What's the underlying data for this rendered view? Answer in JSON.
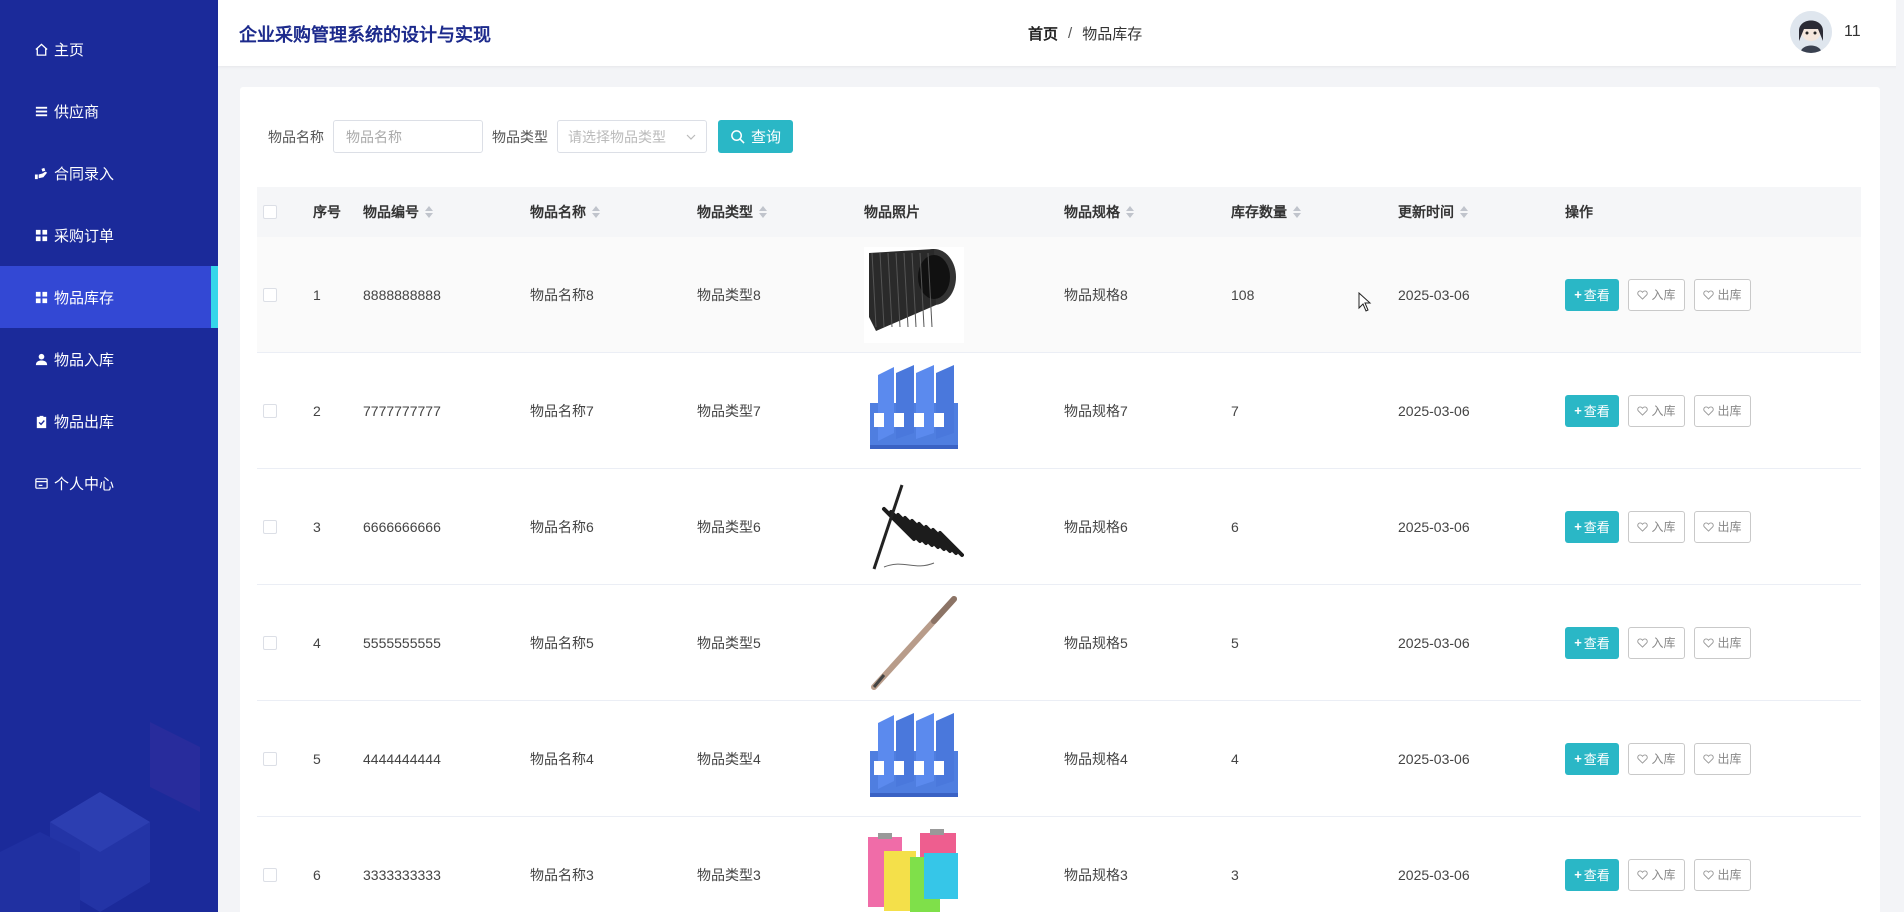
{
  "app_title": "企业采购管理系统的设计与实现",
  "breadcrumb": {
    "home": "首页",
    "separator": "/",
    "current": "物品库存"
  },
  "user": {
    "name": "11"
  },
  "sidebar": {
    "items": [
      {
        "label": "主页",
        "icon": "home-icon"
      },
      {
        "label": "供应商",
        "icon": "list-icon"
      },
      {
        "label": "合同录入",
        "icon": "hand-icon"
      },
      {
        "label": "采购订单",
        "icon": "grid-icon"
      },
      {
        "label": "物品库存",
        "icon": "grid-icon",
        "active": true
      },
      {
        "label": "物品入库",
        "icon": "user-icon"
      },
      {
        "label": "物品出库",
        "icon": "clipboard-icon"
      },
      {
        "label": "个人中心",
        "icon": "card-icon"
      }
    ]
  },
  "filter": {
    "name_label": "物品名称",
    "name_placeholder": "物品名称",
    "type_label": "物品类型",
    "type_placeholder": "请选择物品类型",
    "query_label": "查询"
  },
  "table": {
    "headers": [
      "序号",
      "物品编号",
      "物品名称",
      "物品类型",
      "物品照片",
      "物品规格",
      "库存数量",
      "更新时间",
      "操作"
    ],
    "rows": [
      {
        "index": "1",
        "code": "8888888888",
        "name": "物品名称8",
        "type": "物品类型8",
        "photo": "pen-holder",
        "spec": "物品规格8",
        "qty": "108",
        "time": "2025-03-06"
      },
      {
        "index": "2",
        "code": "7777777777",
        "name": "物品名称7",
        "type": "物品类型7",
        "photo": "file-rack",
        "spec": "物品规格7",
        "qty": "7",
        "time": "2025-03-06"
      },
      {
        "index": "3",
        "code": "6666666666",
        "name": "物品名称6",
        "type": "物品类型6",
        "photo": "gel-pens",
        "spec": "物品规格6",
        "qty": "6",
        "time": "2025-03-06"
      },
      {
        "index": "4",
        "code": "5555555555",
        "name": "物品名称5",
        "type": "物品类型5",
        "photo": "fountain-pen",
        "spec": "物品规格5",
        "qty": "5",
        "time": "2025-03-06"
      },
      {
        "index": "5",
        "code": "4444444444",
        "name": "物品名称4",
        "type": "物品类型4",
        "photo": "file-rack",
        "spec": "物品规格4",
        "qty": "4",
        "time": "2025-03-06"
      },
      {
        "index": "6",
        "code": "3333333333",
        "name": "物品名称3",
        "type": "物品类型3",
        "photo": "clipboards",
        "spec": "物品规格3",
        "qty": "3",
        "time": "2025-03-06"
      }
    ],
    "actions": {
      "view": "查看",
      "in": "入库",
      "out": "出库"
    }
  },
  "colors": {
    "sidebar": "#1b2a9a",
    "sidebar_active": "#3348d4",
    "active_marker": "#35d6ea",
    "accent": "#2ab7c6",
    "title": "#1c2a8c"
  }
}
